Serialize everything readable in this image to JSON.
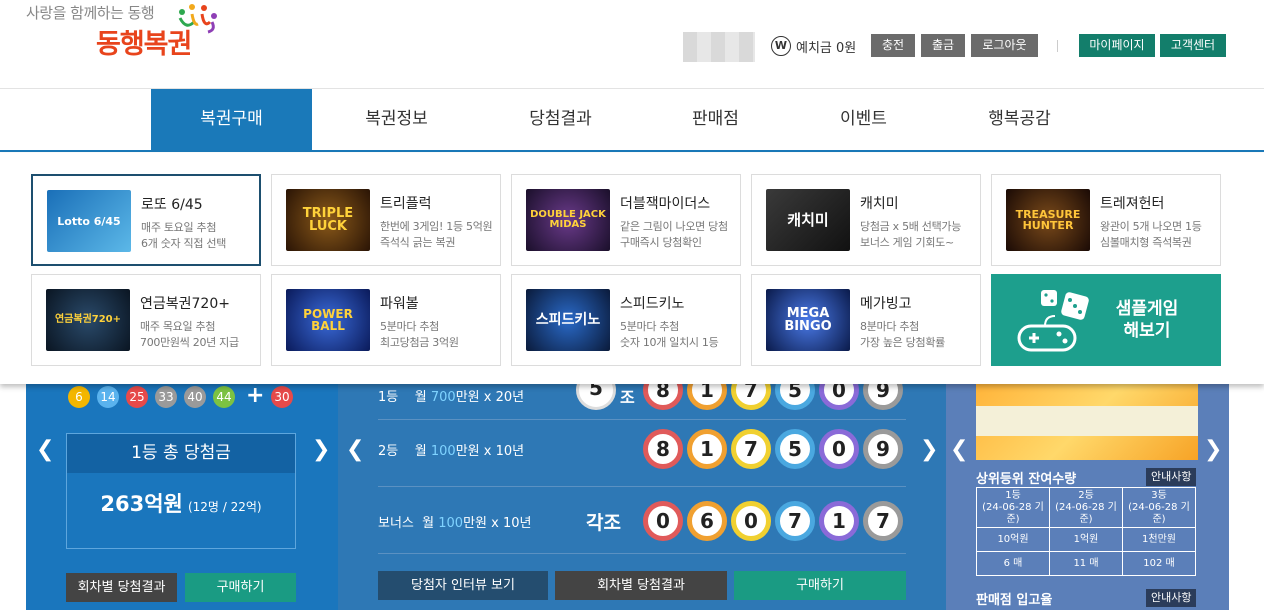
{
  "header": {
    "slogan": "사랑을 함께하는 동행",
    "logo_text": "동행복권",
    "deposit_label": "예치금 0원",
    "coin_icon_letter": "W",
    "buttons": {
      "charge": "충전",
      "withdraw": "출금",
      "logout": "로그아웃",
      "mypage": "마이페이지",
      "support": "고객센터"
    },
    "colors": {
      "gray_button": "#6b6b6b",
      "teal_button": "#137e6b",
      "logo": "#e8441c"
    }
  },
  "gnb": {
    "items": [
      {
        "label": "복권구매",
        "active": true
      },
      {
        "label": "복권정보"
      },
      {
        "label": "당첨결과"
      },
      {
        "label": "판매점"
      },
      {
        "label": "이벤트"
      },
      {
        "label": "행복공감"
      }
    ],
    "accent": "#1a79b9"
  },
  "games": [
    {
      "name": "로또 6/45",
      "desc1": "매주 토요일 추첨",
      "desc2": "6개 숫자 직접 선택",
      "thumb": "Lotto 6/45",
      "selected": true
    },
    {
      "name": "트리플럭",
      "desc1": "한번에 3게임! 1등 5억원",
      "desc2": "즉석식 긁는 복권",
      "thumb": "TRIPLE LUCK"
    },
    {
      "name": "더블잭마이더스",
      "desc1": "같은 그림이 나오면 당첨",
      "desc2": "구매즉시 당첨확인",
      "thumb": "DOUBLE JACK MIDAS"
    },
    {
      "name": "캐치미",
      "desc1": "당첨금 x 5배 선택가능",
      "desc2": "보너스 게임 기회도~",
      "thumb": "캐치미"
    },
    {
      "name": "트레져헌터",
      "desc1": "왕관이 5개 나오면 1등",
      "desc2": "심볼매치형 즉석복권",
      "thumb": "TREASURE HUNTER"
    },
    {
      "name": "연금복권720+",
      "desc1": "매주 목요일 추첨",
      "desc2": "700만원씩 20년 지급",
      "thumb": "연금복권720+"
    },
    {
      "name": "파워볼",
      "desc1": "5분마다 추첨",
      "desc2": "최고당첨금 3억원",
      "thumb": "POWER BALL"
    },
    {
      "name": "스피드키노",
      "desc1": "5분마다 추첨",
      "desc2": "숫자 10개 일치시 1등",
      "thumb": "스피드키노"
    },
    {
      "name": "메가빙고",
      "desc1": "8분마다 추첨",
      "desc2": "가장 높은 당첨확률",
      "thumb": "MEGA BINGO"
    }
  ],
  "sample_game": {
    "line1": "샘플게임",
    "line2": "해보기",
    "icon": "gamepad-dice-icon"
  },
  "lotto_panel": {
    "balls": [
      "6",
      "14",
      "25",
      "33",
      "40",
      "44"
    ],
    "plus": "+",
    "bonus": "30",
    "total_title": "1등 총 당첨금",
    "total_amount": "263억원",
    "total_detail": "(12명 / 22억)",
    "btn_results": "회차별 당첨결과",
    "btn_buy": "구매하기"
  },
  "pension_panel": {
    "row1_rank": "1등",
    "row1_prize_a": "월 ",
    "row1_amount": "700",
    "row1_prize_b": "만원 x 20년",
    "row1_group": "5",
    "row1_jo": "조",
    "row1_digits": [
      "8",
      "1",
      "7",
      "5",
      "0",
      "9"
    ],
    "row2_rank": "2등",
    "row2_prize_a": "월 ",
    "row2_amount": "100",
    "row2_prize_b": "만원 x 10년",
    "row2_digits": [
      "8",
      "1",
      "7",
      "5",
      "0",
      "9"
    ],
    "row3_rank": "보너스",
    "row3_prize_a": "월 ",
    "row3_amount": "100",
    "row3_prize_b": "만원 x 10년",
    "row3_each": "각조",
    "row3_digits": [
      "0",
      "6",
      "0",
      "7",
      "1",
      "7"
    ],
    "btn_interview": "당첨자 인터뷰 보기",
    "btn_results": "회차별 당첨결과",
    "btn_buy": "구매하기"
  },
  "instant_panel": {
    "stock_title": "상위등위 잔여수량",
    "notice": "안내사항",
    "headers": [
      "1등",
      "2등",
      "3등"
    ],
    "dates": [
      "(24-06-28 기준)",
      "(24-06-28 기준)",
      "(24-06-28 기준)"
    ],
    "amounts": [
      "10억원",
      "1억원",
      "1천만원"
    ],
    "counts": [
      "6 매",
      "11 매",
      "102 매"
    ],
    "store_title": "판매점 입고율",
    "store_notice": "안내사항"
  }
}
